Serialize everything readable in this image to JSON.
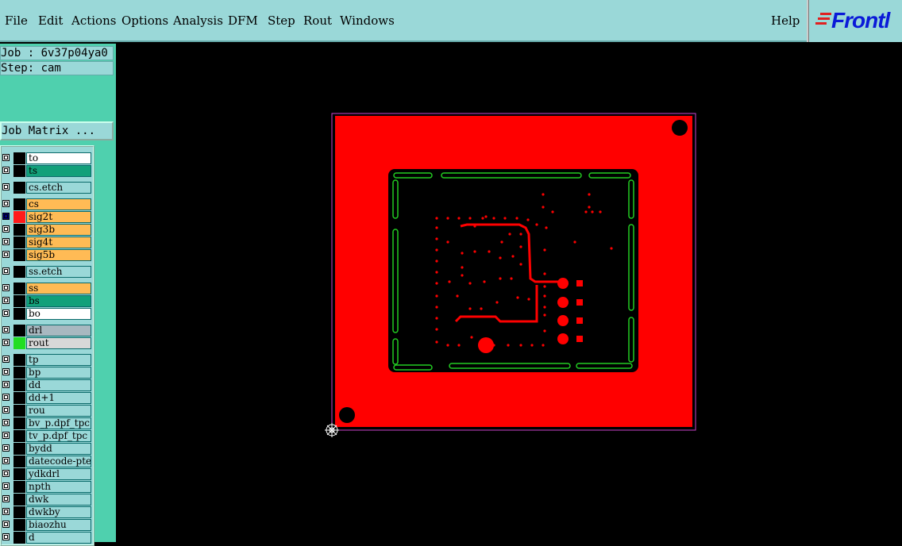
{
  "menu": {
    "file": "File",
    "edit": "Edit",
    "actions": "Actions",
    "options": "Options",
    "analysis": "Analysis",
    "dfm": "DFM",
    "step": "Step",
    "rout": "Rout",
    "windows": "Windows",
    "help": "Help"
  },
  "logo": {
    "text": "Frontl"
  },
  "job": {
    "label": "Job : 6v37p04ya0",
    "step": "Step: cam",
    "matrix_button": "Job Matrix ..."
  },
  "layers": [
    {
      "name": "to",
      "color": "#ffffff",
      "swatch": "#000000"
    },
    {
      "name": "ts",
      "color": "#12a07a",
      "swatch": "#000000"
    },
    {
      "name": "cs.etch",
      "color": "#9ad8d8",
      "swatch": "#000000"
    },
    {
      "name": "cs",
      "color": "#ffbb55",
      "swatch": "#000000"
    },
    {
      "name": "sig2t",
      "color": "#ffbb55",
      "swatch": "#ff1a1a"
    },
    {
      "name": "sig3b",
      "color": "#ffbb55",
      "swatch": "#000000"
    },
    {
      "name": "sig4t",
      "color": "#ffbb55",
      "swatch": "#000000"
    },
    {
      "name": "sig5b",
      "color": "#ffbb55",
      "swatch": "#000000"
    },
    {
      "name": "ss.etch",
      "color": "#9ad8d8",
      "swatch": "#000000"
    },
    {
      "name": "ss",
      "color": "#ffbb55",
      "swatch": "#000000"
    },
    {
      "name": "bs",
      "color": "#12a07a",
      "swatch": "#000000"
    },
    {
      "name": "bo",
      "color": "#ffffff",
      "swatch": "#000000"
    },
    {
      "name": "drl",
      "color": "#a8b8c0",
      "swatch": "#000000"
    },
    {
      "name": "rout",
      "color": "#d8d8d8",
      "swatch": "#22dd22"
    },
    {
      "name": "tp",
      "color": "#9ad8d8",
      "swatch": "#000000"
    },
    {
      "name": "bp",
      "color": "#9ad8d8",
      "swatch": "#000000"
    },
    {
      "name": "dd",
      "color": "#9ad8d8",
      "swatch": "#000000"
    },
    {
      "name": "dd+1",
      "color": "#9ad8d8",
      "swatch": "#000000"
    },
    {
      "name": "rou",
      "color": "#9ad8d8",
      "swatch": "#000000"
    },
    {
      "name": "bv_p.dpf_tpc",
      "color": "#9ad8d8",
      "swatch": "#000000"
    },
    {
      "name": "tv_p.dpf_tpc",
      "color": "#9ad8d8",
      "swatch": "#000000"
    },
    {
      "name": "bydd",
      "color": "#9ad8d8",
      "swatch": "#000000"
    },
    {
      "name": "datecode-pte",
      "color": "#9ad8d8",
      "swatch": "#000000"
    },
    {
      "name": "ydkdrl",
      "color": "#9ad8d8",
      "swatch": "#000000"
    },
    {
      "name": "npth",
      "color": "#9ad8d8",
      "swatch": "#000000"
    },
    {
      "name": "dwk",
      "color": "#9ad8d8",
      "swatch": "#000000"
    },
    {
      "name": "dwkby",
      "color": "#9ad8d8",
      "swatch": "#000000"
    },
    {
      "name": "biaozhu",
      "color": "#9ad8d8",
      "swatch": "#000000"
    },
    {
      "name": "d",
      "color": "#9ad8d8",
      "swatch": "#000000"
    }
  ],
  "colors": {
    "copper": "#ff0000",
    "outline": "#22cc22",
    "background": "#000000"
  },
  "icons": {
    "origin": "crosshair-icon"
  }
}
